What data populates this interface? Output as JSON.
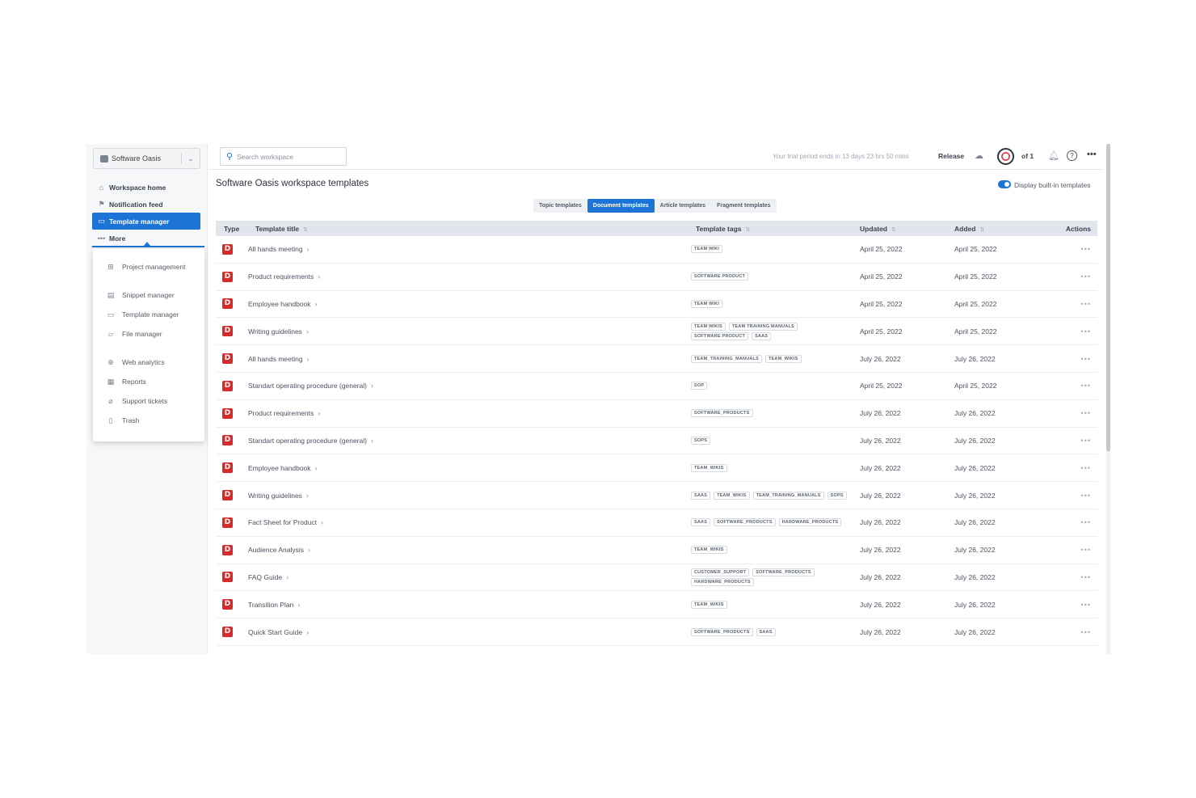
{
  "workspace": {
    "name": "Software Oasis"
  },
  "nav": [
    {
      "label": "Workspace home",
      "icon": "home-icon",
      "glyph": "⌂",
      "active": false
    },
    {
      "label": "Notification feed",
      "icon": "feed-icon",
      "glyph": "⚑",
      "active": false
    },
    {
      "label": "Template manager",
      "icon": "template-icon",
      "glyph": "▭",
      "active": true
    },
    {
      "label": "More",
      "icon": "more-icon",
      "glyph": "•••",
      "active": false
    }
  ],
  "more_menu": [
    {
      "label": "Project management",
      "icon": "project-icon",
      "glyph": "⊞"
    },
    {
      "label": "Snippet manager",
      "icon": "snippet-icon",
      "glyph": "▤"
    },
    {
      "label": "Template manager",
      "icon": "template-icon",
      "glyph": "▭"
    },
    {
      "label": "File manager",
      "icon": "folder-icon",
      "glyph": "▱"
    },
    {
      "label": "Web analytics",
      "icon": "globe-icon",
      "glyph": "⊕"
    },
    {
      "label": "Reports",
      "icon": "reports-icon",
      "glyph": "▦"
    },
    {
      "label": "Support tickets",
      "icon": "ticket-icon",
      "glyph": "⌀"
    },
    {
      "label": "Trash",
      "icon": "trash-icon",
      "glyph": "▯"
    }
  ],
  "topbar": {
    "search_placeholder": "Search workspace",
    "trial_text": "Your trial period ends in 13 days 23 hrs 50 mins",
    "release_label": "Release",
    "of_label": "of 1",
    "help_glyph": "?",
    "more_glyph": "•••"
  },
  "page": {
    "title": "Software Oasis workspace templates",
    "toggle_label": "Display built-in templates",
    "toggle_on": true
  },
  "tabs": [
    {
      "label": "Topic templates",
      "active": false
    },
    {
      "label": "Document templates",
      "active": true
    },
    {
      "label": "Article templates",
      "active": false
    },
    {
      "label": "Fragment templates",
      "active": false
    }
  ],
  "table": {
    "headers": {
      "type": "Type",
      "title": "Template title",
      "tags": "Template tags",
      "updated": "Updated",
      "added": "Added",
      "actions": "Actions"
    },
    "rows": [
      {
        "title": "All hands meeting",
        "tags": [
          "TEAM WIKI"
        ],
        "updated": "April 25, 2022",
        "added": "April 25, 2022"
      },
      {
        "title": "Product requirements",
        "tags": [
          "SOFTWARE PRODUCT"
        ],
        "updated": "April 25, 2022",
        "added": "April 25, 2022"
      },
      {
        "title": "Employee handbook",
        "tags": [
          "TEAM WIKI"
        ],
        "updated": "April 25, 2022",
        "added": "April 25, 2022"
      },
      {
        "title": "Writing guidelines",
        "tags": [
          "TEAM WIKIS",
          "TEAM TRAINING MANUALS",
          "SOFTWARE PRODUCT",
          "SAAS"
        ],
        "updated": "April 25, 2022",
        "added": "April 25, 2022"
      },
      {
        "title": "All hands meeting",
        "tags": [
          "TEAM_TRAINING_MANUALS",
          "TEAM_WIKIS"
        ],
        "updated": "July 26, 2022",
        "added": "July 26, 2022"
      },
      {
        "title": "Standart operating procedure (general)",
        "tags": [
          "SOP"
        ],
        "updated": "April 25, 2022",
        "added": "April 25, 2022"
      },
      {
        "title": "Product requirements",
        "tags": [
          "SOFTWARE_PRODUCTS"
        ],
        "updated": "July 26, 2022",
        "added": "July 26, 2022"
      },
      {
        "title": "Standart operating procedure (general)",
        "tags": [
          "SOPS"
        ],
        "updated": "July 26, 2022",
        "added": "July 26, 2022"
      },
      {
        "title": "Employee handbook",
        "tags": [
          "TEAM_WIKIS"
        ],
        "updated": "July 26, 2022",
        "added": "July 26, 2022"
      },
      {
        "title": "Writing guidelines",
        "tags": [
          "SAAS",
          "TEAM_WIKIS",
          "TEAM_TRAINING_MANUALS",
          "SOPS"
        ],
        "updated": "July 26, 2022",
        "added": "July 26, 2022"
      },
      {
        "title": "Fact Sheet for Product",
        "tags": [
          "SAAS",
          "SOFTWARE_PRODUCTS",
          "HARDWARE_PRODUCTS"
        ],
        "updated": "July 26, 2022",
        "added": "July 26, 2022"
      },
      {
        "title": "Audience Analysis",
        "tags": [
          "TEAM_WIKIS"
        ],
        "updated": "July 26, 2022",
        "added": "July 26, 2022"
      },
      {
        "title": "FAQ Guide",
        "tags": [
          "CUSTOMER_SUPPORT",
          "SOFTWARE_PRODUCTS",
          "HARDWARE_PRODUCTS"
        ],
        "updated": "July 26, 2022",
        "added": "July 26, 2022"
      },
      {
        "title": "Transition Plan",
        "tags": [
          "TEAM_WIKIS"
        ],
        "updated": "July 26, 2022",
        "added": "July 26, 2022"
      },
      {
        "title": "Quick Start Guide",
        "tags": [
          "SOFTWARE_PRODUCTS",
          "SAAS"
        ],
        "updated": "July 26, 2022",
        "added": "July 26, 2022"
      }
    ],
    "type_glyph": "D",
    "chevron_glyph": "›",
    "actions_glyph": "•••"
  },
  "colors": {
    "accent": "#1d74d7",
    "type_icon": "#d52b2b"
  }
}
